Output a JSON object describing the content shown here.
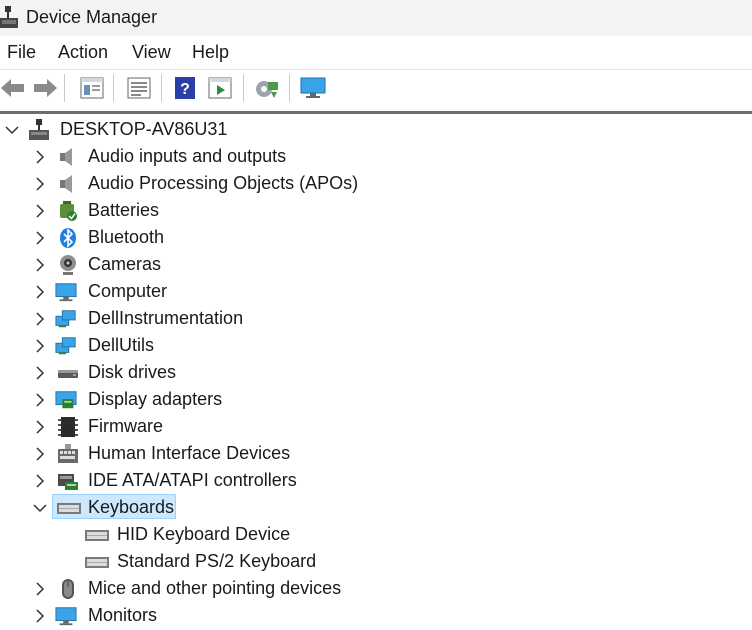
{
  "window": {
    "title": "Device Manager"
  },
  "menu": {
    "items": [
      "File",
      "Action",
      "View",
      "Help"
    ]
  },
  "toolbar": {
    "buttons": [
      "back-icon",
      "forward-icon",
      "properties-panel-icon",
      "list-view-icon",
      "help-icon",
      "run-icon",
      "scan-hardware-icon",
      "monitor-icon"
    ]
  },
  "tree": {
    "root": "DESKTOP-AV86U31",
    "categories": [
      "Audio inputs and outputs",
      "Audio Processing Objects (APOs)",
      "Batteries",
      "Bluetooth",
      "Cameras",
      "Computer",
      "DellInstrumentation",
      "DellUtils",
      "Disk drives",
      "Display adapters",
      "Firmware",
      "Human Interface Devices",
      "IDE ATA/ATAPI controllers",
      "Keyboards",
      "Mice and other pointing devices",
      "Monitors"
    ],
    "keyboards_children": [
      "HID Keyboard Device",
      "Standard PS/2 Keyboard"
    ],
    "selected": "Keyboards"
  },
  "colors": {
    "selection_bg": "#cce8ff",
    "selection_border": "#99d1ff",
    "accent": "#0078d4"
  }
}
